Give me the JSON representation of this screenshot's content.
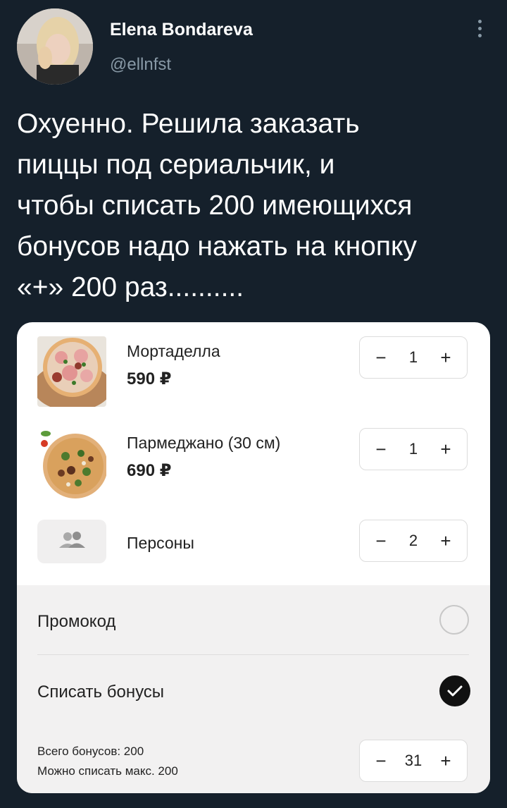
{
  "author": {
    "name": "Elena Bondareva",
    "handle": "@ellnfst"
  },
  "tweet": {
    "text": "Охуенно. Решила заказать\nпиццы под сериальчик, и\nчтобы списать 200 имеющихся\nбонусов надо нажать на кнопку\n«+» 200 раз.........."
  },
  "cart": {
    "items": [
      {
        "name": "Мортаделла",
        "price": "590 ₽",
        "qty": "1",
        "image_icon": "pizza-mortadella-photo"
      },
      {
        "name": "Пармеджано (30 см)",
        "price": "690 ₽",
        "qty": "1",
        "image_icon": "pizza-parmigiano-photo"
      }
    ],
    "persons": {
      "label": "Персоны",
      "qty": "2",
      "icon": "people-icon"
    },
    "minus": "−",
    "plus": "+",
    "promo_label": "Промокод",
    "bonus_label": "Списать бонусы",
    "bonus_checked": true,
    "bonus_total": "Всего бонусов:  200",
    "bonus_max": "Можно списать макс. 200",
    "bonus_qty": "31"
  },
  "colors": {
    "background": "#15202b",
    "card": "#ffffff",
    "muted": "#8899a6",
    "check": "#111111"
  }
}
